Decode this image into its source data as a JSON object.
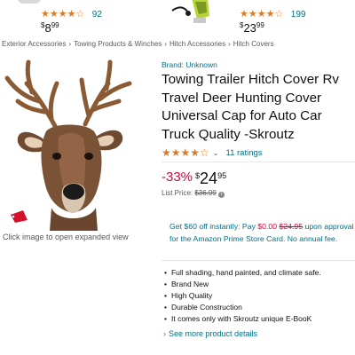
{
  "related": [
    {
      "stars": "★★★★☆",
      "count": "92",
      "currency": "$",
      "price_whole": "8",
      "price_fraction": "99"
    },
    {
      "stars": "★★★★☆",
      "count": "199",
      "currency": "$",
      "price_whole": "23",
      "price_fraction": "99"
    }
  ],
  "breadcrumb": [
    "Exterior Accessories",
    "Towing Products & Winches",
    "Hitch Accessories",
    "Hitch Covers"
  ],
  "breadcrumb_separator": "›",
  "image": {
    "badge": "SALE",
    "caption": "Click image to open expanded view"
  },
  "product": {
    "brand": "Brand: Unknown",
    "title": "Towing Trailer Hitch Cover Rv Travel Deer Hunting Cover Universal Cap for Auto Car Truck Quality -Skroutz",
    "stars": "★★★★☆",
    "rating_value": 4.5,
    "rating_count": "11 ratings"
  },
  "price": {
    "discount": "-33%",
    "currency": "$",
    "whole": "24",
    "fraction": "95",
    "list_label": "List Price: ",
    "list_value": "$36.99"
  },
  "offer": {
    "part1": "Get $60 off instantly: Pay ",
    "pay": "$0.00",
    "space": " ",
    "was": "$24.95",
    "part2": " upon approval for the Amazon Prime Store Card. No annual fee."
  },
  "bullets": [
    "Full shading, hand painted, and climate safe.",
    "Brand New",
    "High Quality",
    "Durable Construction",
    "It comes only with Skroutz unique E-BooK"
  ],
  "see_more": "See more product details",
  "colors": {
    "link": "#007185",
    "star": "#de7921",
    "deal": "#cc0c39",
    "text": "#0f1111",
    "muted": "#565959"
  }
}
